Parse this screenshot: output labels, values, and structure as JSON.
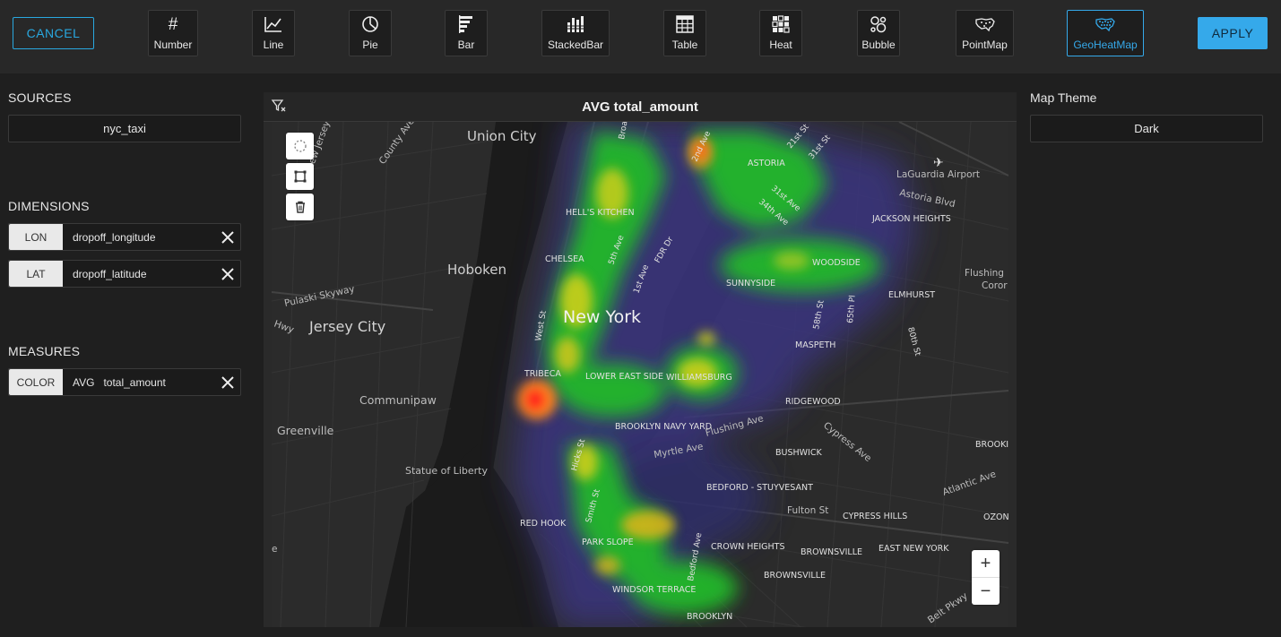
{
  "toolbar": {
    "cancel_label": "CANCEL",
    "apply_label": "APPLY",
    "chart_types": [
      {
        "label": "Number",
        "icon": "number-icon"
      },
      {
        "label": "Line",
        "icon": "line-chart-icon"
      },
      {
        "label": "Pie",
        "icon": "pie-chart-icon"
      },
      {
        "label": "Bar",
        "icon": "bar-chart-icon"
      },
      {
        "label": "StackedBar",
        "icon": "stacked-bar-icon"
      },
      {
        "label": "Table",
        "icon": "table-icon"
      },
      {
        "label": "Heat",
        "icon": "heat-grid-icon"
      },
      {
        "label": "Bubble",
        "icon": "bubble-icon"
      },
      {
        "label": "PointMap",
        "icon": "us-map-icon"
      },
      {
        "label": "GeoHeatMap",
        "icon": "us-map-heat-icon",
        "selected": true
      }
    ],
    "accent_color": "#35a9ea"
  },
  "sources": {
    "title": "SOURCES",
    "value": "nyc_taxi"
  },
  "dimensions": {
    "title": "DIMENSIONS",
    "items": [
      {
        "tag": "LON",
        "field": "dropoff_longitude"
      },
      {
        "tag": "LAT",
        "field": "dropoff_latitude"
      }
    ]
  },
  "measures": {
    "title": "MEASURES",
    "items": [
      {
        "tag": "COLOR",
        "field": "AVG   total_amount"
      }
    ]
  },
  "chart": {
    "title": "AVG total_amount"
  },
  "map": {
    "labels": {
      "union_city": "Union City",
      "hoboken": "Hoboken",
      "jersey_city": "Jersey City",
      "communipaw": "Communipaw",
      "greenville": "Greenville",
      "statue": "Statue of Liberty",
      "new_york": "New York",
      "hells_kitchen": "HELL'S KITCHEN",
      "chelsea": "CHELSEA",
      "tribeca": "TRIBECA",
      "lower_east_side": "LOWER EAST SIDE",
      "williamsburg": "WILLIAMSBURG",
      "brooklyn_navy_yard": "BROOKLYN NAVY YARD",
      "red_hook": "RED HOOK",
      "park_slope": "PARK SLOPE",
      "windsor_terrace": "WINDSOR TERRACE",
      "brooklyn": "BROOKLYN",
      "bedford_stuyvesant": "BEDFORD - STUYVESANT",
      "crown_heights": "CROWN HEIGHTS",
      "bushwick": "BUSHWICK",
      "ridgewood": "RIDGEWOOD",
      "maspeth": "MASPETH",
      "sunnyside": "SUNNYSIDE",
      "woodside": "WOODSIDE",
      "astoria": "ASTORIA",
      "jackson_heights": "JACKSON HEIGHTS",
      "elmhurst": "ELMHURST",
      "laguardia": "LaGuardia Airport",
      "astoria_blvd": "Astoria Blvd",
      "flushing": "Flushing",
      "corona": "Coror",
      "cypress_hills": "CYPRESS HILLS",
      "east_new_york": "EAST NEW YORK",
      "brownsville": "BROWNSVILLE",
      "brownsville2": "BROWNSVILLE",
      "ozone": "OZONE",
      "brooklyn_manor": "BROOKI MANO",
      "atlantic_ave": "Atlantic Ave",
      "fulton_st": "Fulton St",
      "myrtle_ave": "Myrtle Ave",
      "flushing_ave": "Flushing Ave",
      "cypress_ave": "Cypress Ave",
      "bedford_ave": "Bedford Ave",
      "hicks_st": "Hicks St",
      "smith_st": "Smith St",
      "west_st": "West St",
      "fifth_ave": "5th Ave",
      "first_ave": "1st Ave",
      "fdr_dr": "FDR Dr",
      "second_ave": "2nd Ave",
      "twentyfirst_st": "21st St",
      "thirtyfirst_st": "31st St",
      "thirtyfirst_ave": "31st Ave",
      "thirtyfourth_ave": "34th Ave",
      "fiftyeighth_st": "58th St",
      "sixtyfifth_pl": "65th Pl",
      "eightieth_st": "80th St",
      "county_ave": "County Ave",
      "pulaski": "Pulaski Skyway",
      "belt_pkwy": "Belt Pkwy",
      "hwy": "Hwy",
      "new_jersey_tpk": "New Jersey Tpk",
      "broadway": "Broad",
      "partial_e": "e"
    },
    "zoom_in": "+",
    "zoom_out": "−"
  },
  "map_theme": {
    "label": "Map Theme",
    "value": "Dark"
  }
}
